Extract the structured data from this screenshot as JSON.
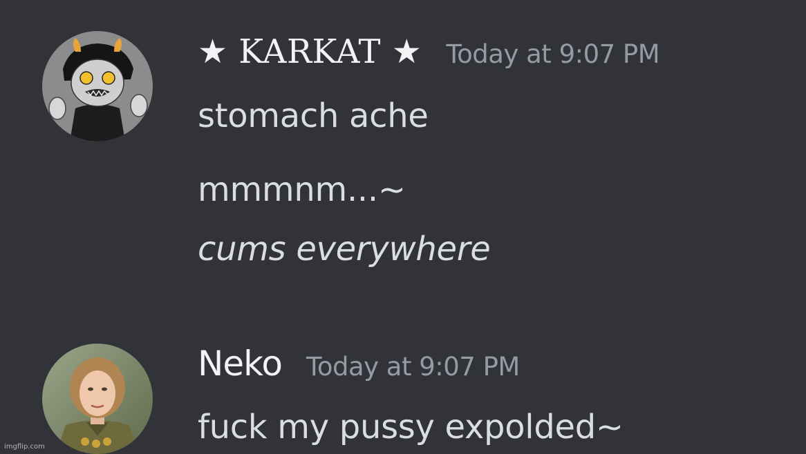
{
  "messages": {
    "karkat": {
      "username": "★ KARKAT ★",
      "timestamp": "Today at 9:07 PM",
      "lines": [
        "stomach ache",
        "mmmnm...~",
        "cums everywhere"
      ]
    },
    "neko": {
      "username": "Neko",
      "timestamp": "Today at 9:07 PM",
      "lines": [
        "fuck my pussy expolded~"
      ]
    }
  },
  "watermark": "imgflip.com",
  "colors": {
    "background": "#313338",
    "username": "#f2f3f5",
    "timestamp": "#949ba4",
    "message_text": "#dbdee1"
  },
  "icons": {
    "karkat_avatar": "karkat-avatar-image",
    "neko_avatar": "neko-avatar-image"
  }
}
